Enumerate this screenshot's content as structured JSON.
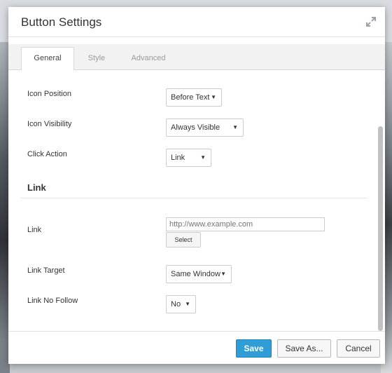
{
  "dialog": {
    "title": "Button Settings"
  },
  "tabs": [
    {
      "label": "General",
      "active": true
    },
    {
      "label": "Style",
      "active": false
    },
    {
      "label": "Advanced",
      "active": false
    }
  ],
  "fields": {
    "icon_position": {
      "label": "Icon Position",
      "value": "Before Text"
    },
    "icon_visibility": {
      "label": "Icon Visibility",
      "value": "Always Visible"
    },
    "click_action": {
      "label": "Click Action",
      "value": "Link"
    }
  },
  "link_section": {
    "title": "Link",
    "link": {
      "label": "Link",
      "placeholder": "http://www.example.com",
      "select_label": "Select"
    },
    "link_target": {
      "label": "Link Target",
      "value": "Same Window"
    },
    "link_no_follow": {
      "label": "Link No Follow",
      "value": "No"
    }
  },
  "footer": {
    "save": "Save",
    "save_as": "Save As...",
    "cancel": "Cancel"
  },
  "colors": {
    "primary": "#2f9ed6"
  },
  "icons": {
    "expand": "expand-arrows-icon",
    "dropdown": "caret-down-icon"
  }
}
